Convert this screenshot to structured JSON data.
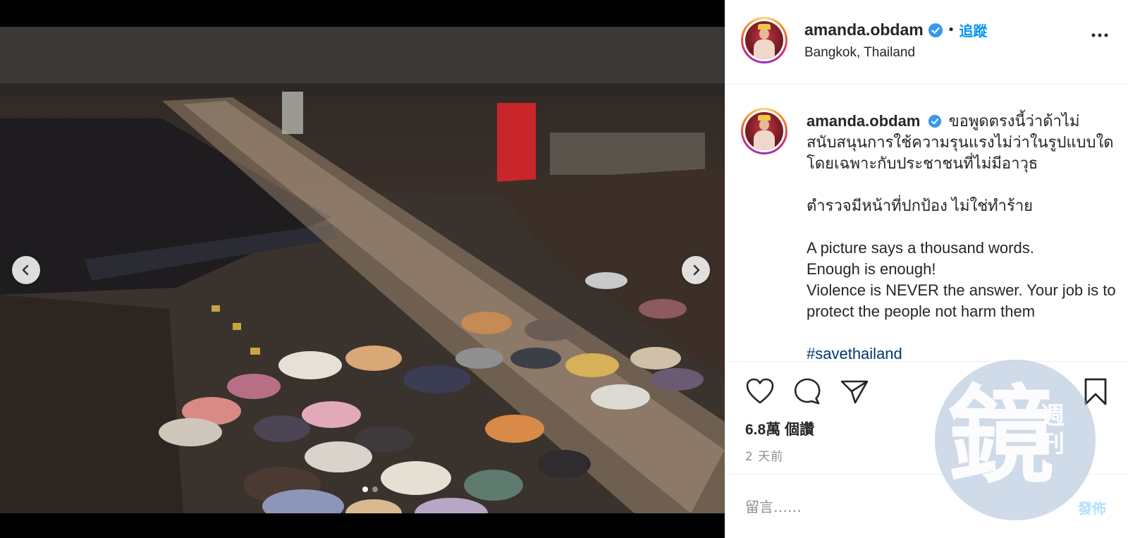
{
  "post": {
    "username": "amanda.obdam",
    "separator": "•",
    "follow_label": "追蹤",
    "location": "Bangkok, Thailand"
  },
  "caption": {
    "username": "amanda.obdam",
    "thai_para1": "ขอพูดตรงนี้ว่าด้าไม่สนับสนุนการใช้ความรุนแรงไม่ว่าในรูปแบบใด โดยเฉพาะกับประชาชนที่ไม่มีอาวุธ",
    "thai_para2": "ตำรวจมีหน้าที่ปกป้อง ไม่ใช่ทำร้าย",
    "en_line1": "A picture says a thousand words.",
    "en_line2": "Enough is enough!",
    "en_line3": "Violence is NEVER the answer. Your job is to protect the people not harm them",
    "hashtag": "#savethailand"
  },
  "stats": {
    "likes": "6.8萬 個讚",
    "time_ago": "2 天前"
  },
  "comment": {
    "placeholder": "留言……",
    "post_label": "發佈"
  },
  "watermark": {
    "main_char": "鏡",
    "side_chars": "週刊"
  },
  "carousel": {
    "slide_count": 2,
    "active_index": 0
  },
  "colors": {
    "link_blue": "#0095f6",
    "verified_blue": "#3897f0",
    "muted_gray": "#8e8e8e"
  },
  "icons": [
    "verified-badge-icon",
    "more-options-icon",
    "heart-icon",
    "comment-icon",
    "share-icon",
    "bookmark-icon",
    "chevron-left-icon",
    "chevron-right-icon"
  ]
}
